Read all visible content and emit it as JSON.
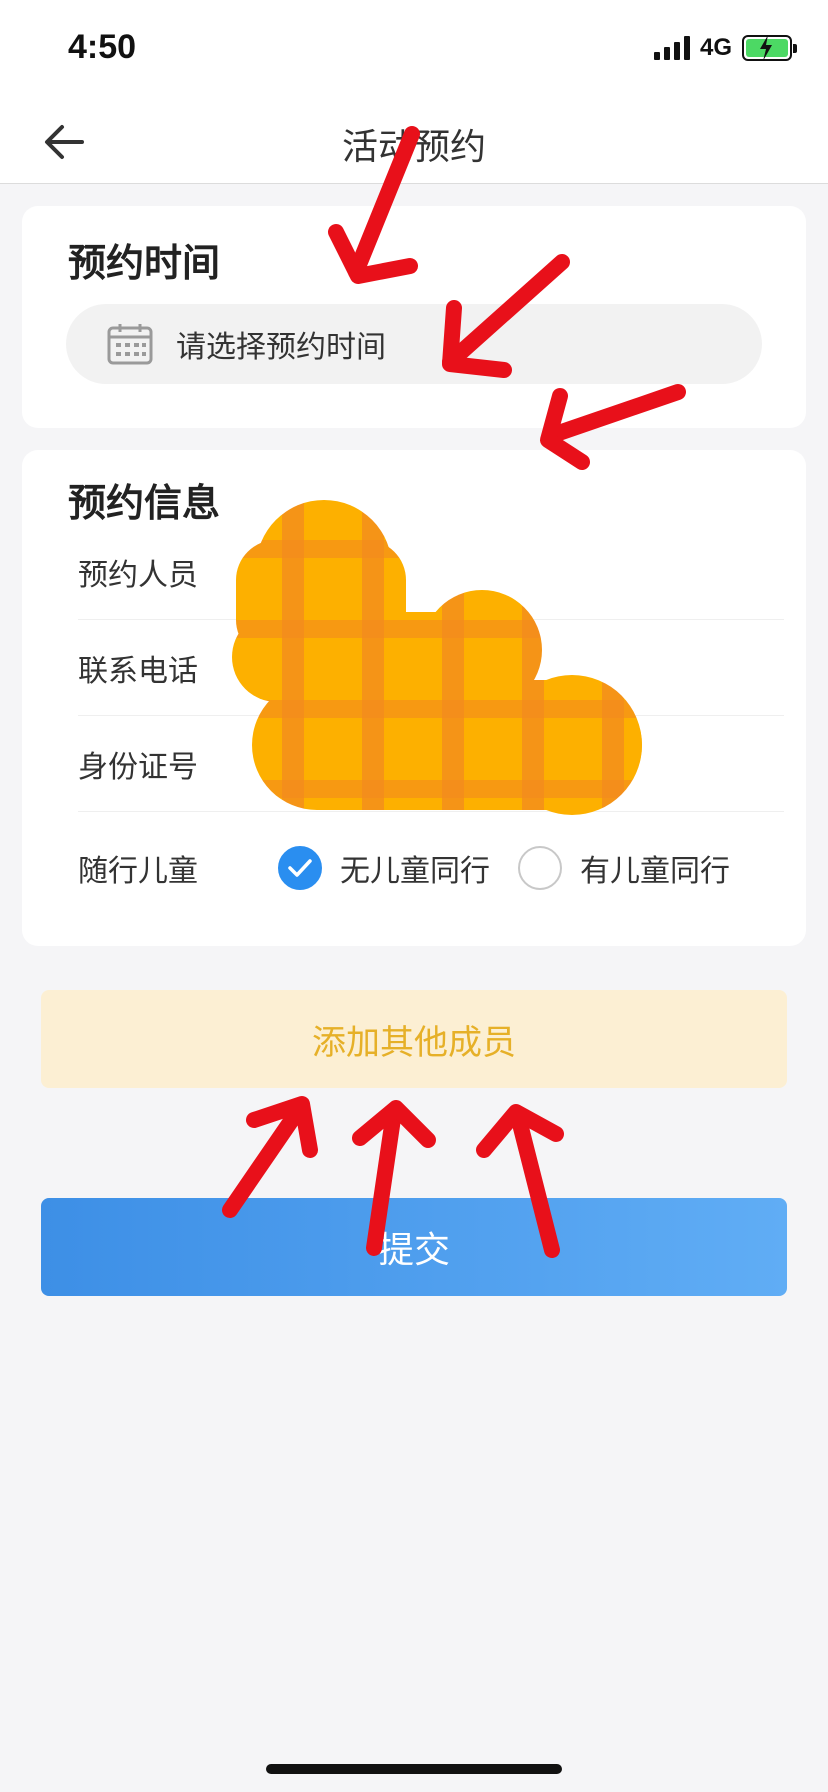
{
  "status_bar": {
    "time": "4:50",
    "network": "4G",
    "icons": [
      "signal-icon",
      "battery-charging-icon"
    ]
  },
  "nav": {
    "title": "活动预约",
    "back_icon": "arrow-left-icon"
  },
  "reservation_time": {
    "title": "预约时间",
    "placeholder": "请选择预约时间",
    "icon": "calendar-icon"
  },
  "reservation_info": {
    "title": "预约信息",
    "fields": [
      {
        "label": "预约人员",
        "value": ""
      },
      {
        "label": "联系电话",
        "value": ""
      },
      {
        "label": "身份证号",
        "value": ""
      }
    ],
    "children": {
      "label": "随行儿童",
      "options": [
        {
          "label": "无儿童同行",
          "checked": true
        },
        {
          "label": "有儿童同行",
          "checked": false
        }
      ]
    }
  },
  "actions": {
    "add_member": "添加其他成员",
    "submit": "提交"
  },
  "colors": {
    "accent_blue": "#2a8ef0",
    "add_member_bg": "#fcefd3",
    "add_member_text": "#e6b028",
    "annotation_red": "#e8101a",
    "redaction_orange": "#fdb000"
  }
}
